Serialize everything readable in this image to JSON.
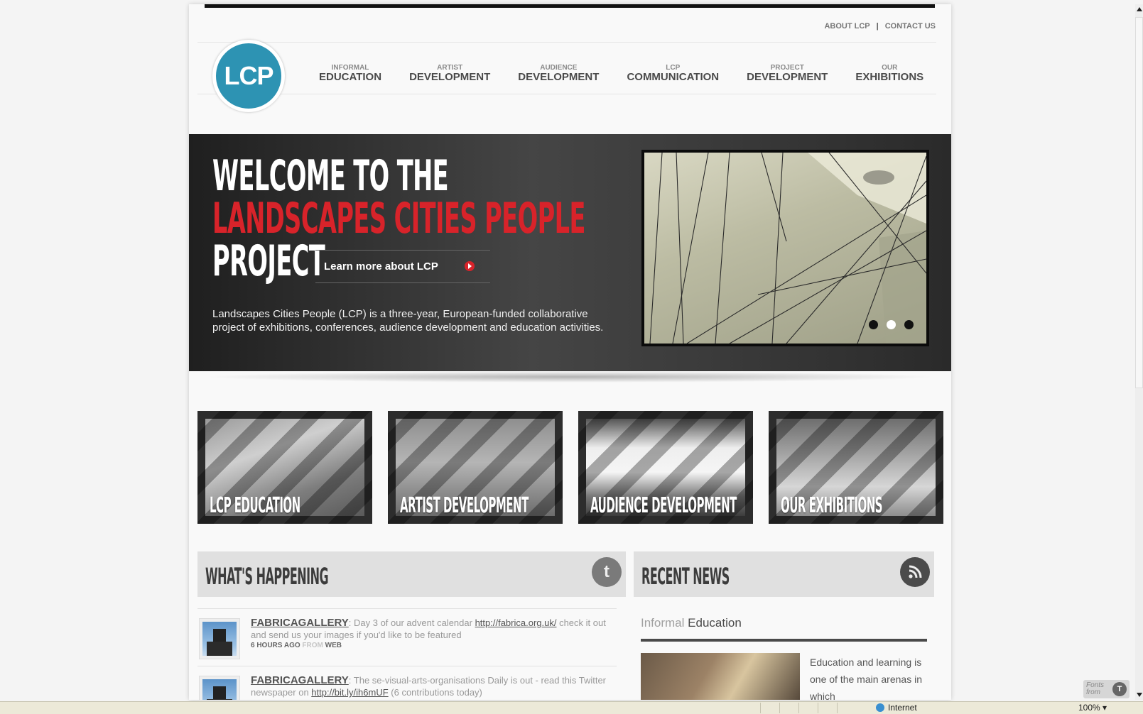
{
  "header": {
    "top_links": [
      "ABOUT LCP",
      "CONTACT US"
    ],
    "separator": "|",
    "logo_text": "LCP",
    "nav": [
      {
        "small": "INFORMAL",
        "large": "EDUCATION"
      },
      {
        "small": "ARTIST",
        "large": "DEVELOPMENT"
      },
      {
        "small": "AUDIENCE",
        "large": "DEVELOPMENT"
      },
      {
        "small": "LCP",
        "large": "COMMUNICATION"
      },
      {
        "small": "PROJECT",
        "large": "DEVELOPMENT"
      },
      {
        "small": "OUR",
        "large": "EXHIBITIONS"
      }
    ]
  },
  "hero": {
    "line1": "WELCOME TO THE",
    "line2": "LANDSCAPES CITIES PEOPLE",
    "line3": "PROJECT",
    "cta": "Learn more about LCP",
    "description": "Landscapes Cities People (LCP) is a three-year, European-funded collaborative project of exhibitions, conferences, audience development and education activities.",
    "slider_active_index": 1,
    "slider_count": 3
  },
  "tiles": [
    "LCP EDUCATION",
    "ARTIST DEVELOPMENT",
    "AUDIENCE DEVELOPMENT",
    "OUR EXHIBITIONS"
  ],
  "whats_happening": {
    "title": "WHAT'S HAPPENING",
    "tweets": [
      {
        "user": "FABRICAGALLERY",
        "before": ": Day 3 of our advent calendar ",
        "link": "http://fabrica.org.uk/",
        "after": " check it out and send us your images if you'd like to be featured",
        "time": "6 HOURS AGO",
        "from_label": "FROM",
        "source": "WEB"
      },
      {
        "user": "FABRICAGALLERY",
        "before": ": The se-visual-arts-organisations Daily is out - read this Twitter newspaper on ",
        "link": "http://bit.ly/ih6mUF",
        "after": " (6 contributions today)",
        "time": "",
        "from_label": "",
        "source": ""
      }
    ]
  },
  "recent_news": {
    "title": "RECENT NEWS",
    "category_a": "Informal",
    "category_b": "Education",
    "excerpt": "Education and learning is one of the main arenas in which"
  },
  "statusbar": {
    "zone": "Internet",
    "zoom": "100%"
  },
  "fonts_badge": {
    "line1": "Fonts",
    "line2": "from"
  },
  "colors": {
    "accent_red": "#d8232a",
    "logo_blue": "#2d93b3"
  }
}
